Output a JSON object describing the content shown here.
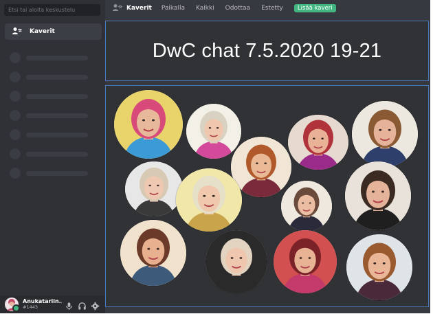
{
  "sidebar": {
    "search_placeholder": "Etsi tai aloita keskustelu",
    "friends_label": "Kaverit",
    "friends_icon": "friends-wave-icon"
  },
  "topbar": {
    "title": "Kaverit",
    "tabs": [
      "Paikalla",
      "Kaikki",
      "Odottaa",
      "Estetty"
    ],
    "add_friend_label": "Lisää kaveri",
    "add_friend_color": "#43b581"
  },
  "event": {
    "title": "DwC chat 7.5.2020 19-21"
  },
  "user": {
    "name": "Anukatariin...",
    "tag": "#1443",
    "status_color": "#43b581"
  },
  "colors": {
    "sidebar_bg": "#2f3136",
    "main_bg": "#36393f",
    "panel_border": "#4a79b8"
  },
  "photos": [
    {
      "bg": "#e9d46b",
      "skin": "#e8b89a",
      "hair": "#d84a7a",
      "top": "#3c9ad6"
    },
    {
      "bg": "#f3f0e8",
      "skin": "#efc7ae",
      "hair": "#d9d2c2",
      "top": "#d34a9a"
    },
    {
      "bg": "#f1e6d6",
      "skin": "#e9b895",
      "hair": "#b05a2c",
      "top": "#7a2a3a"
    },
    {
      "bg": "#e6d9cf",
      "skin": "#e9b297",
      "hair": "#b0323a",
      "top": "#9a2b8a"
    },
    {
      "bg": "#ece7df",
      "skin": "#e4b399",
      "hair": "#8a5a34",
      "top": "#2e3f6b"
    },
    {
      "bg": "#e7e7e7",
      "skin": "#efc8b2",
      "hair": "#d7c9b4",
      "top": "#3a3a3a"
    },
    {
      "bg": "#f0e7a8",
      "skin": "#f0c8ae",
      "hair": "#e6e0c8",
      "top": "#c9a44a"
    },
    {
      "bg": "#efe8de",
      "skin": "#ebbda2",
      "hair": "#6a4a3a",
      "top": "#2a2a3a"
    },
    {
      "bg": "#e9e2da",
      "skin": "#e5b39a",
      "hair": "#3a2a22",
      "top": "#1f1f1f"
    },
    {
      "bg": "#f0e2cc",
      "skin": "#e8b08f",
      "hair": "#6b3a28",
      "top": "#3d5a7a"
    },
    {
      "bg": "#2a2a2a",
      "skin": "#efc6ae",
      "hair": "#e2d4c0",
      "top": "#2a2a2a"
    },
    {
      "bg": "#d25050",
      "skin": "#e8b394",
      "hair": "#7a2228",
      "top": "#c43a6a"
    },
    {
      "bg": "#dfe4e8",
      "skin": "#e9b797",
      "hair": "#9a5a30",
      "top": "#4a2a3a"
    }
  ]
}
